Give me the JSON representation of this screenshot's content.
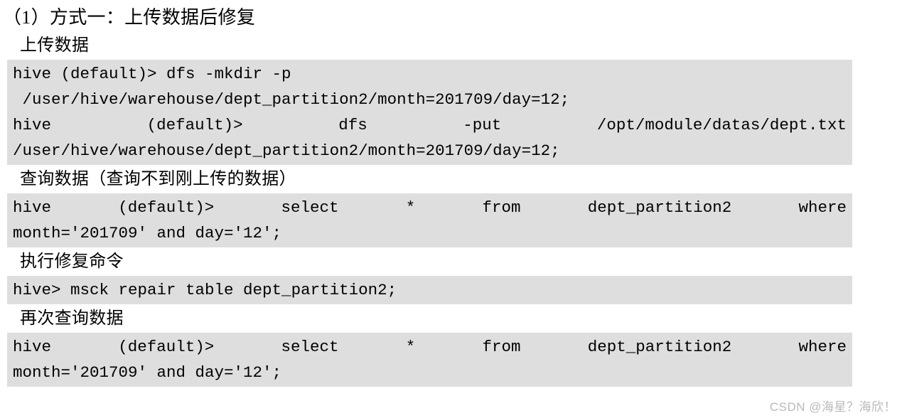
{
  "document": {
    "title": "（1）方式一：上传数据后修复",
    "watermark": "CSDN @海星？海欣！",
    "sections": [
      {
        "heading": "上传数据",
        "lines": [
          {
            "justified": false,
            "text": "hive (default)> dfs -mkdir -p"
          },
          {
            "justified": false,
            "text": " /user/hive/warehouse/dept_partition2/month=201709/day=12;"
          },
          {
            "justified": true,
            "parts": [
              "hive",
              "(default)>",
              "dfs",
              "-put",
              "/opt/module/datas/dept.txt"
            ]
          },
          {
            "justified": false,
            "text": "/user/hive/warehouse/dept_partition2/month=201709/day=12;"
          }
        ]
      },
      {
        "heading": "查询数据（查询不到刚上传的数据）",
        "lines": [
          {
            "justified": true,
            "parts": [
              "hive",
              "(default)>",
              "select",
              "*",
              "from",
              "dept_partition2",
              "where"
            ]
          },
          {
            "justified": false,
            "text": "month='201709' and day='12';"
          }
        ]
      },
      {
        "heading": "执行修复命令",
        "lines": [
          {
            "justified": false,
            "text": "hive> msck repair table dept_partition2;"
          }
        ]
      },
      {
        "heading": "再次查询数据",
        "lines": [
          {
            "justified": true,
            "parts": [
              "hive",
              "(default)>",
              "select",
              "*",
              "from",
              "dept_partition2",
              "where"
            ]
          },
          {
            "justified": false,
            "text": "month='201709' and day='12';"
          }
        ]
      }
    ]
  }
}
